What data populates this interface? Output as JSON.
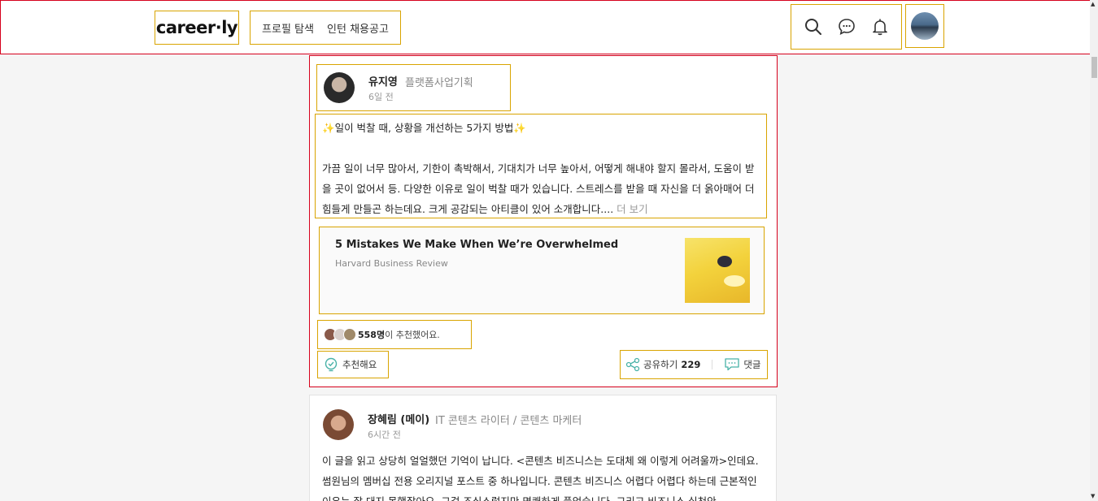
{
  "header": {
    "logo": "career·ly",
    "nav": [
      "프로필 탐색",
      "인턴 채용공고"
    ],
    "icons": [
      "search-icon",
      "chat-icon",
      "bell-icon"
    ]
  },
  "post1": {
    "author_name": "유지영",
    "author_title": "플랫폼사업기획",
    "time": "6일 전",
    "headline": "✨일이 벅찰 때, 상황을 개선하는 5가지 방법✨",
    "body": "가끔 일이 너무 많아서, 기한이 촉박해서, 기대치가 너무 높아서, 어떻게 해내야 할지 몰라서, 도움이 받을 곳이 없어서 등. 다양한 이유로 일이 벅찰 때가 있습니다. 스트레스를 받을 때 자신을 더 옭아매어 더 힘들게 만들곤 하는데요. 크게 공감되는 아티클이 있어 소개합니다....",
    "more": " 더 보기",
    "link_title": "5 Mistakes We Make When We’re Overwhelmed",
    "link_source": "Harvard Business Review",
    "recommend_count": "558명",
    "recommend_text": "이 추천했어요.",
    "like_label": "추천해요",
    "share_label": "공유하기",
    "share_count": "229",
    "comment_label": "댓글"
  },
  "post2": {
    "author_name": "장혜림 (메이)",
    "author_title": "IT 콘텐츠 라이터 / 콘텐츠 마케터",
    "time": "6시간 전",
    "body": "이 글을 읽고 상당히 얼얼했던 기억이 납니다. <콘텐츠 비즈니스는 도대체 왜 이렇게 어려울까>인데요. 썸원님의 멤버십 전용 오리지널 포스트 중 하나입니다. 콘텐츠 비즈니스 어렵다 어렵다 하는데 근본적인 이유는 잘 대지 못했잖아요. 그걸 조심스럽지만 명쾌하게 풀었습니다. 그리고 비즈니스 실천안"
  },
  "colors": {
    "highlight_red": "#d6001c",
    "highlight_gold": "#d9a400"
  }
}
